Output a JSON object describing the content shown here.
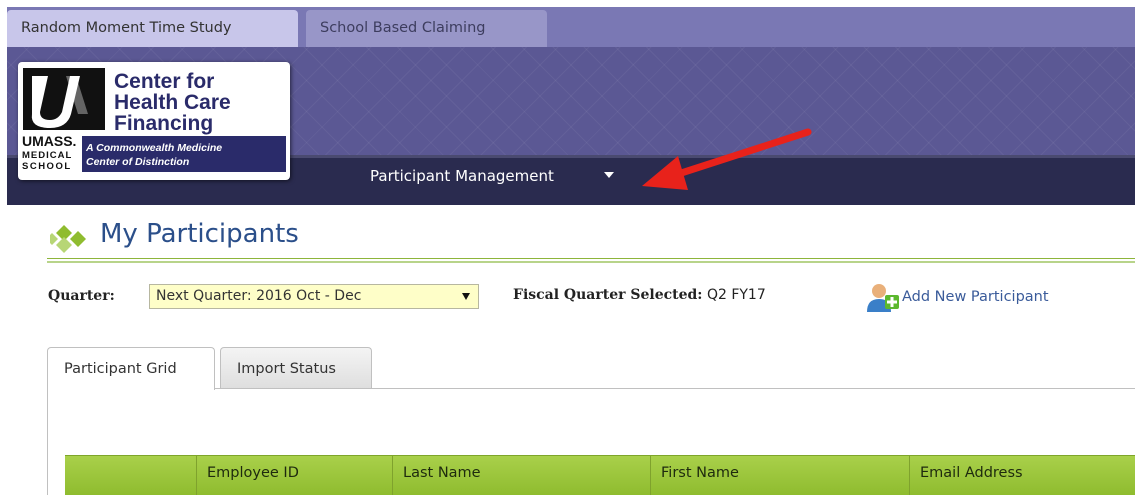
{
  "app_tabs": [
    {
      "label": "Random Moment Time Study",
      "active": true
    },
    {
      "label": "School Based Claiming",
      "active": false
    }
  ],
  "logo": {
    "line1": "Center for",
    "line2": "Health Care",
    "line3": "Financing",
    "umass": "UMASS.",
    "medical": "MEDICAL",
    "school": "SCHOOL",
    "tagline1": "A Commonwealth Medicine",
    "tagline2": "Center of Distinction"
  },
  "nav": {
    "menu_label": "Participant Management"
  },
  "page": {
    "title": "My Participants"
  },
  "filters": {
    "quarter_label": "Quarter:",
    "quarter_value": "Next Quarter: 2016 Oct - Dec",
    "fiscal_label": "Fiscal Quarter Selected:",
    "fiscal_value": "Q2 FY17",
    "add_participant_label": "Add New Participant"
  },
  "tabs": [
    {
      "label": "Participant Grid",
      "active": true
    },
    {
      "label": "Import Status",
      "active": false
    }
  ],
  "grid": {
    "columns": [
      "",
      "Employee ID",
      "Last Name",
      "First Name",
      "Email Address"
    ]
  },
  "colors": {
    "header_purple": "#5b5894",
    "navbar": "#2a2b4f",
    "grid_green": "#9bc43a",
    "title_blue": "#2b4f8a",
    "arrow_red": "#e8221b"
  }
}
